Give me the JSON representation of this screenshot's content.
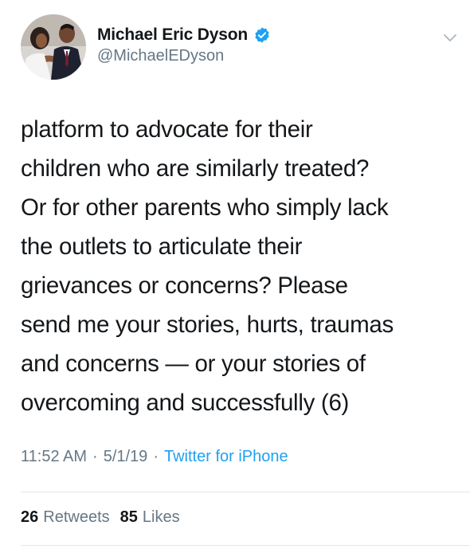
{
  "author": {
    "display_name": "Michael Eric Dyson",
    "handle": "@MichaelEDyson",
    "verified": true,
    "avatar_icon": "profile-photo"
  },
  "tweet": {
    "lines": [
      "platform to advocate for their",
      "children who are similarly treated?",
      "Or for other parents who simply lack",
      "the outlets to articulate their",
      "grievances or concerns? Please",
      "send me your stories, hurts, traumas",
      "and concerns — or your stories of",
      "overcoming and successfully (6)"
    ]
  },
  "meta": {
    "time": "11:52 AM",
    "separator": "·",
    "date": "5/1/19",
    "source": "Twitter for iPhone"
  },
  "stats": {
    "retweets_count": "26",
    "retweets_label": "Retweets",
    "likes_count": "85",
    "likes_label": "Likes"
  },
  "colors": {
    "text": "#14171a",
    "secondary": "#657786",
    "accent": "#1da1f2",
    "divider": "#e1e8ed"
  }
}
